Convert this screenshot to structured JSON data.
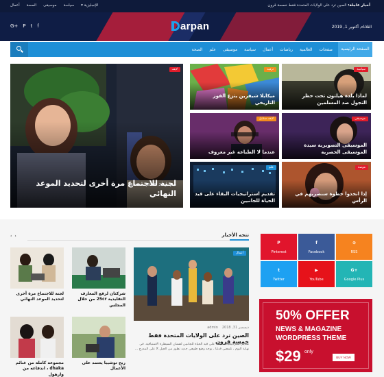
{
  "topbar": {
    "ticker_label": "أخبار عاجلة:",
    "ticker_text": "الصين ترد على الولايات المتحدة فقط خمسة قرون",
    "links": [
      "الإنجليزية ▾",
      "سياسة",
      "موسيقى",
      "الصحة",
      "أعمال"
    ]
  },
  "header": {
    "logo": "arpan",
    "date": "الثلاثاء, أكتوبر 1, 2019",
    "social": [
      "G+",
      "P",
      "t",
      "f"
    ]
  },
  "nav": {
    "home": "الصفحة الرئيسية",
    "items": [
      "صفحات",
      "العالمية",
      "رياضات",
      "أعمال",
      "سياسة",
      "موسيقى",
      "علم",
      "الصحة"
    ]
  },
  "hero": {
    "category": "لايف",
    "title": "لجنة للاجتماع مرة أخرى لتحديد الموعد النهائي",
    "date": "ديسمبر 26, 2018",
    "author": "admin"
  },
  "tiles": [
    {
      "category": "سياسة",
      "title": "لماذا بلدة هيلتون تحت حظر التجول ضد المسلمين"
    },
    {
      "category": "ترفيه",
      "title": "ميكايلا شيفرين يتزع الفوز التاريخي"
    },
    {
      "category": "موسيقى",
      "title": "الموسيقى التصويرية سيدة الموسيقى الحصرية"
    },
    {
      "category": "لايف ستايل",
      "title": "عندما لا الطباعة غير معروف"
    },
    {
      "category": "موضة",
      "title": "إذا اتخذوا خطوة سنضربهم في الرأس"
    },
    {
      "category": "علم",
      "title": "تقديم استراتيجيات البقاء على قيد الحياة للجانبين"
    }
  ],
  "section": {
    "title": "تتجه الأخبار",
    "arrows": [
      "‹",
      "›"
    ]
  },
  "big_card": {
    "category": "أعمال",
    "date": "ديسمبر 31, 2018",
    "author": "admin",
    "title": "الصين ترد على الولايات المتحدة فقط خمسة قرون",
    "excerpt": "تقديم استراتيجيات البقاء على قيد الحياة للجانبين لضمان السيطرة الاستباقية. في نهاية اليوم ، تلمضي قدمًا ، يوجد وضع طبيعي جديد تطور من الجيل X على المدرج ..."
  },
  "small_cards": [
    {
      "title": "شركتان لرفع المعارف التقليدية 25cr من خلال المجلس"
    },
    {
      "title": "لجنة للاجتماع مرة أخرى لتحديد الموعد النهائي"
    },
    {
      "title": "ربح توشيبا يعتمد على الأعمال"
    },
    {
      "title": "مجموعة كاملة من غنائم dhaka ، اندفاعه من وارهول"
    }
  ],
  "social_boxes": [
    {
      "label": "Pinterest",
      "icon": "P",
      "color": "#e1152c"
    },
    {
      "label": "Facebook",
      "icon": "f",
      "color": "#3b5a98"
    },
    {
      "label": "RSS",
      "icon": "⊙",
      "color": "#f6831f"
    },
    {
      "label": "Twitter",
      "icon": "t",
      "color": "#1da1f2"
    },
    {
      "label": "YouTube",
      "icon": "▶",
      "color": "#e6121a"
    },
    {
      "label": "Google Plus",
      "icon": "G+",
      "color": "#23b5b5"
    }
  ],
  "ad": {
    "headline": "50% OFFER",
    "sub1": "NEWS & MAGAZINE",
    "sub2": "WORDPRESS THEME",
    "price": "$29",
    "only": "only",
    "button": "BUY NOW"
  }
}
